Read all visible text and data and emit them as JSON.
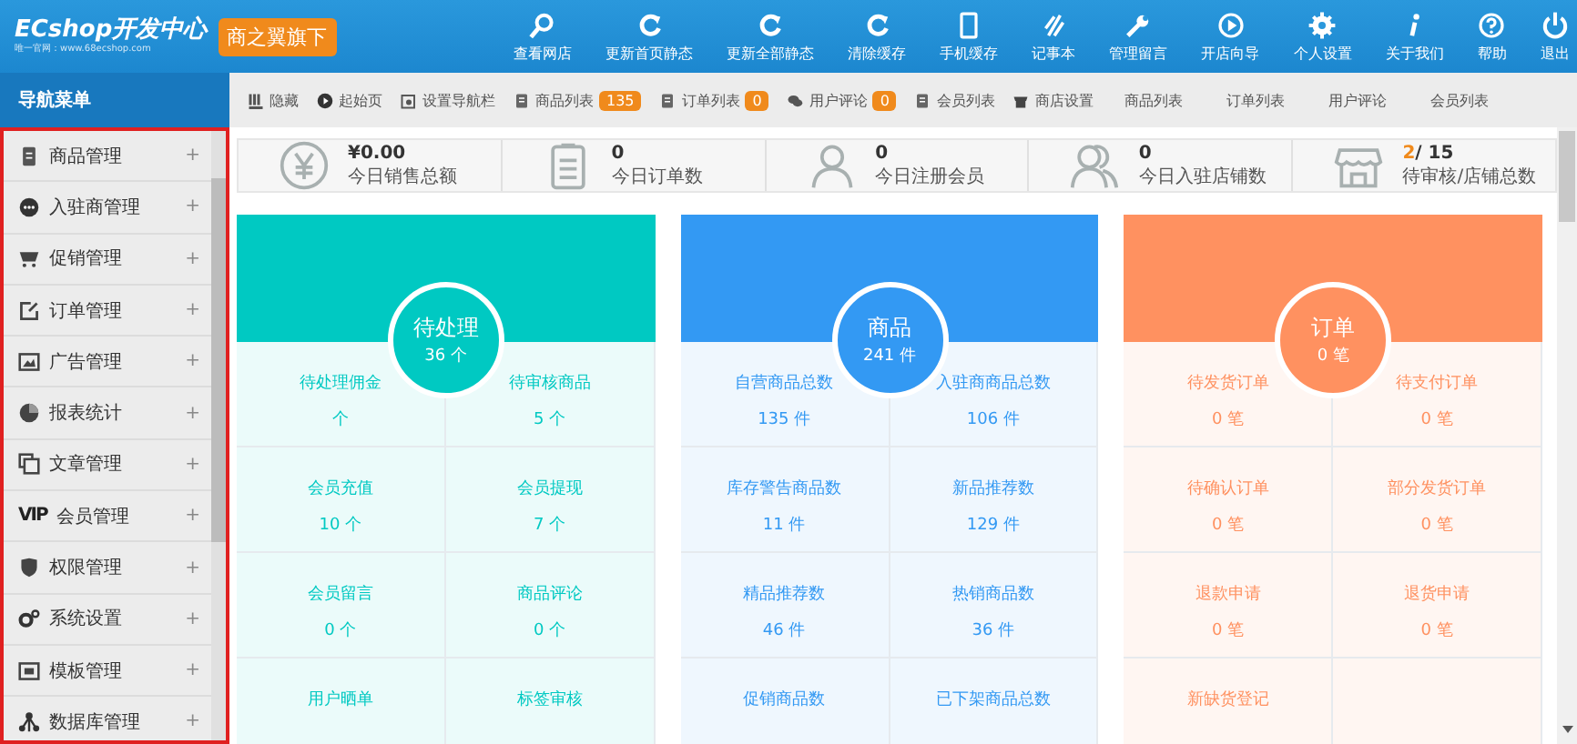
{
  "header": {
    "logo": "ECshop开发中心",
    "tagline": "唯一官网：www.68ecshop.com",
    "badge": "商之翼旗下",
    "nav": [
      {
        "label": "查看网店"
      },
      {
        "label": "更新首页静态"
      },
      {
        "label": "更新全部静态"
      },
      {
        "label": "清除缓存"
      },
      {
        "label": "手机缓存"
      },
      {
        "label": "记事本"
      },
      {
        "label": "管理留言"
      },
      {
        "label": "开店向导"
      },
      {
        "label": "个人设置"
      },
      {
        "label": "关于我们"
      },
      {
        "label": "帮助"
      },
      {
        "label": "退出"
      }
    ]
  },
  "sidebar": {
    "title": "导航菜单",
    "items": [
      {
        "label": "商品管理",
        "expand": "+"
      },
      {
        "label": "入驻商管理",
        "expand": "+"
      },
      {
        "label": "促销管理",
        "expand": "+"
      },
      {
        "label": "订单管理",
        "expand": "+"
      },
      {
        "label": "广告管理",
        "expand": "+"
      },
      {
        "label": "报表统计",
        "expand": "+"
      },
      {
        "label": "文章管理",
        "expand": "+"
      },
      {
        "label": "会员管理",
        "iconText": "VIP",
        "expand": "+"
      },
      {
        "label": "权限管理",
        "expand": "+"
      },
      {
        "label": "系统设置",
        "expand": "+"
      },
      {
        "label": "模板管理",
        "expand": "+"
      },
      {
        "label": "数据库管理",
        "expand": "+"
      }
    ]
  },
  "toolbar": [
    {
      "kind": "tool",
      "label": "隐藏"
    },
    {
      "kind": "tool",
      "label": "起始页"
    },
    {
      "kind": "tool",
      "label": "设置导航栏"
    },
    {
      "kind": "tool",
      "label": "商品列表",
      "badge": "135"
    },
    {
      "kind": "tool",
      "label": "订单列表",
      "badge": "0"
    },
    {
      "kind": "tool",
      "label": "用户评论",
      "badge": "0"
    },
    {
      "kind": "tool",
      "label": "会员列表"
    },
    {
      "kind": "tool",
      "label": "商店设置"
    },
    {
      "kind": "tab",
      "label": "商品列表"
    },
    {
      "kind": "tab",
      "label": "订单列表"
    },
    {
      "kind": "tab",
      "label": "用户评论"
    },
    {
      "kind": "tab",
      "label": "会员列表"
    }
  ],
  "stats": [
    {
      "value": "¥0.00",
      "label": "今日销售总额"
    },
    {
      "value": "0",
      "label": "今日订单数"
    },
    {
      "value": "0",
      "label": "今日注册会员"
    },
    {
      "value": "0",
      "label": "今日入驻店铺数"
    },
    {
      "value": "2",
      "value_total": "/ 15",
      "label": "待审核/店铺总数"
    }
  ],
  "cards": [
    {
      "title": "待处理",
      "count": "36 个",
      "color": "#00c9c2",
      "cells": [
        {
          "label": "待处理佣金",
          "value": "个"
        },
        {
          "label": "待审核商品",
          "value": "5 个"
        },
        {
          "label": "会员充值",
          "value": "10 个"
        },
        {
          "label": "会员提现",
          "value": "7 个"
        },
        {
          "label": "会员留言",
          "value": "0 个"
        },
        {
          "label": "商品评论",
          "value": "0 个"
        },
        {
          "label": "用户晒单"
        },
        {
          "label": "标签审核"
        }
      ]
    },
    {
      "title": "商品",
      "count": "241 件",
      "color": "#3399f3",
      "cells": [
        {
          "label": "自营商品总数",
          "value": "135 件"
        },
        {
          "label": "入驻商商品总数",
          "value": "106 件"
        },
        {
          "label": "库存警告商品数",
          "value": "11 件"
        },
        {
          "label": "新品推荐数",
          "value": "129 件"
        },
        {
          "label": "精品推荐数",
          "value": "46 件"
        },
        {
          "label": "热销商品数",
          "value": "36 件"
        },
        {
          "label": "促销商品数"
        },
        {
          "label": "已下架商品总数"
        }
      ]
    },
    {
      "title": "订单",
      "count": "0 笔",
      "color": "#ff9160",
      "cells": [
        {
          "label": "待发货订单",
          "value": "0 笔"
        },
        {
          "label": "待支付订单",
          "value": "0 笔"
        },
        {
          "label": "待确认订单",
          "value": "0 笔"
        },
        {
          "label": "部分发货订单",
          "value": "0 笔"
        },
        {
          "label": "退款申请",
          "value": "0 笔"
        },
        {
          "label": "退货申请",
          "value": "0 笔"
        },
        {
          "label": "新缺货登记"
        }
      ]
    }
  ]
}
